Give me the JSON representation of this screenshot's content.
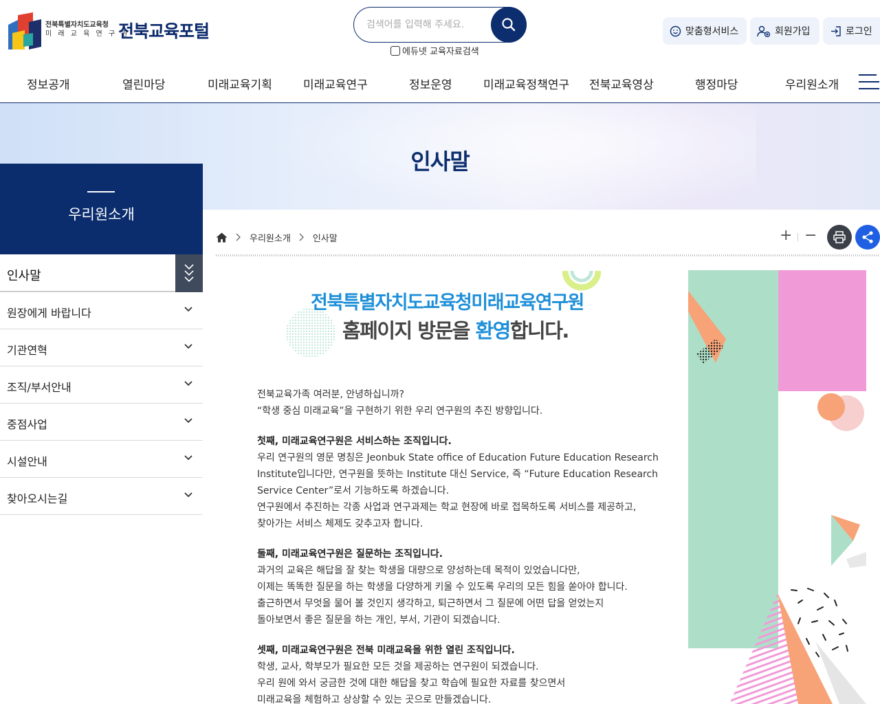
{
  "header": {
    "logo_sub_line1": "전북특별자치도교육청",
    "logo_sub_line2": "미 래 교 육 연 구 원",
    "logo_title": "전북교육포털",
    "search_placeholder": "검색어를 입력해 주세요.",
    "edunet_label": "에듀넷 교육자료검색",
    "util_custom": "맞춤형서비스",
    "util_join": "회원가입",
    "util_login": "로그인"
  },
  "gnb": {
    "items": [
      "정보공개",
      "열린마당",
      "미래교육기획",
      "미래교육연구",
      "정보운영",
      "미래교육정책연구",
      "전북교육영상",
      "행정마당",
      "우리원소개"
    ]
  },
  "visual": {
    "page_title": "인사말"
  },
  "sidebar": {
    "title": "우리원소개",
    "items": [
      "인사말",
      "원장에게 바랍니다",
      "기관연혁",
      "조직/부서안내",
      "중점사업",
      "시설안내",
      "찾아오시는길"
    ]
  },
  "breadcrumb": {
    "level1": "우리원소개",
    "level2": "인사말"
  },
  "tools": {
    "zoom_in": "+",
    "zoom_out": "−"
  },
  "content": {
    "greeting_line1": "전북특별자치도교육청미래교육연구원",
    "greeting_line2_a": "홈페이지 방문을 ",
    "greeting_line2_hl": "환영",
    "greeting_line2_b": "합니다.",
    "intro": [
      "전북교육가족 여러분, 안녕하십니까?",
      "“학생 중심 미래교육”을 구현하기 위한 우리 연구원의 추진 방향입니다."
    ],
    "section1_heading": "첫째, 미래교육연구원은 서비스하는 조직입니다.",
    "section1": [
      "우리 연구원의 영문 명칭은 Jeonbuk State office of Education Future Education Research",
      "Institute입니다만, 연구원을 뜻하는 Institute 대신 Service, 즉 “Future Education Research",
      "Service Center”로서 기능하도록 하겠습니다.",
      "연구원에서 추진하는 각종 사업과 연구과제는 학교 현장에 바로 접목하도록 서비스를 제공하고,",
      "찾아가는 서비스 체제도 갖추고자 합니다."
    ],
    "section2_heading": "둘째, 미래교육연구원은 질문하는 조직입니다.",
    "section2": [
      "과거의 교육은 해답을 잘 찾는 학생을 대량으로 양성하는데 목적이 있었습니다만,",
      "이제는 똑똑한 질문을 하는 학생을 다양하게 키울 수 있도록 우리의 모든 힘을 쏟아야 합니다.",
      "출근하면서 무엇을 물어 볼 것인지 생각하고, 퇴근하면서 그 질문에 어떤 답을 얻었는지",
      "돌아보면서 좋은 질문을 하는 개인, 부서, 기관이 되겠습니다."
    ],
    "section3_heading": "셋째, 미래교육연구원은 전북 미래교육을 위한 열린 조직입니다.",
    "section3": [
      "학생, 교사, 학부모가 필요한 모든 것을 제공하는 연구원이 되겠습니다.",
      "우리 원에 와서 궁금한 것에 대한 해답을 찾고 학습에 필요한 자료를 찾으면서",
      "미래교육을 체험하고 상상할 수 있는 곳으로 만들겠습니다."
    ]
  },
  "colors": {
    "navy": "#0b2d6e",
    "accent_blue": "#1e8fd8",
    "share_blue": "#1f5fe3",
    "mint": "#addfc8",
    "pink": "#f19ad8",
    "orange": "#f7a277"
  }
}
